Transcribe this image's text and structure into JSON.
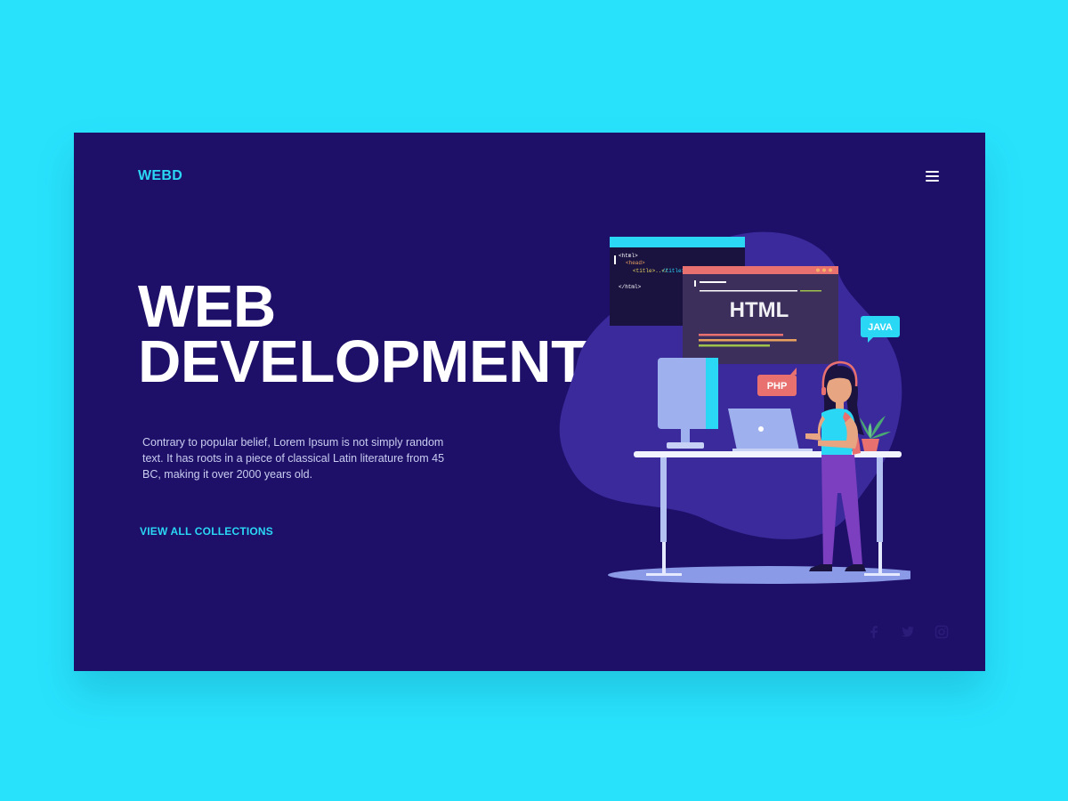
{
  "header": {
    "logo": "WEBD",
    "menu_icon": "hamburger-menu-icon"
  },
  "hero": {
    "title_line1": "WEB",
    "title_line2": "DEVELOPMENT",
    "description": "Contrary to popular belief, Lorem Ipsum is not simply random text. It has roots in a piece of classical Latin literature from 45 BC, making it over 2000 years old.",
    "cta_label": "VIEW ALL COLLECTIONS"
  },
  "illustration": {
    "code_window": {
      "line1": "<html>",
      "line2": "<head>",
      "line3": "<title>..</",
      "line3b": "/title>",
      "line4": "</html>"
    },
    "html_window_label": "HTML",
    "tags": [
      "JAVA",
      "PHP"
    ]
  },
  "social": {
    "icons": [
      "facebook-icon",
      "twitter-icon",
      "instagram-icon"
    ]
  },
  "colors": {
    "background": "#28e2fc",
    "card": "#1e1069",
    "accent": "#2ad7f5",
    "text": "#ffffff",
    "blob": "#3a2a9c",
    "code_window": "#1a1340",
    "html_window": "#3d2f5c",
    "window_bar_pink": "#e8706e",
    "tag_pink": "#e8706e"
  }
}
